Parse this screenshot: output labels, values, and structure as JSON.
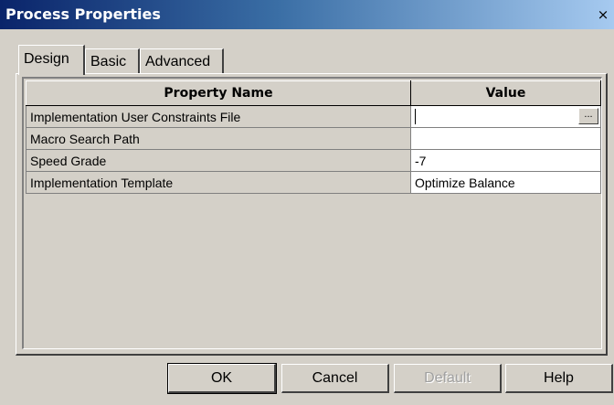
{
  "window": {
    "title": "Process Properties",
    "close_glyph": "×"
  },
  "tabs": [
    {
      "label": "Design"
    },
    {
      "label": "Basic"
    },
    {
      "label": "Advanced"
    }
  ],
  "grid": {
    "columns": [
      "Property Name",
      "Value"
    ],
    "rows": [
      {
        "name": "Implementation User Constraints File",
        "value": ""
      },
      {
        "name": "Macro Search Path",
        "value": ""
      },
      {
        "name": "Speed Grade",
        "value": "-7"
      },
      {
        "name": "Implementation Template",
        "value": "Optimize Balance"
      }
    ],
    "browse_label": "..."
  },
  "buttons": {
    "ok": "OK",
    "cancel": "Cancel",
    "default": "Default",
    "help": "Help"
  }
}
